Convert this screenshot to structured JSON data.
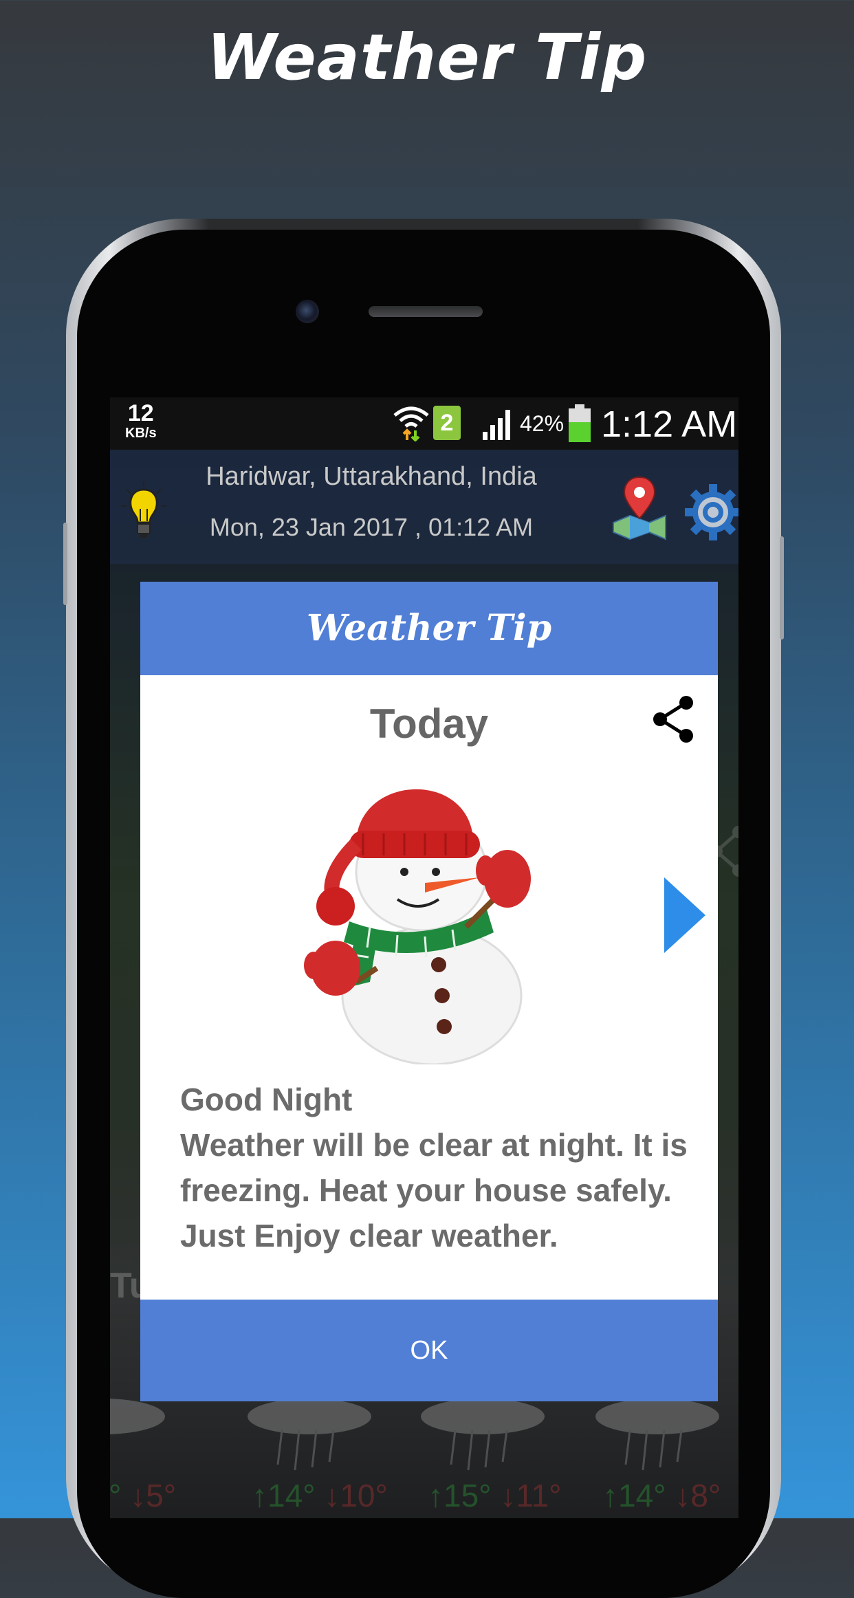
{
  "promo": {
    "title": "Weather Tip"
  },
  "status_bar": {
    "speed_value": "12",
    "speed_unit": "KB/s",
    "sim_slot": "2",
    "battery_percent": "42%",
    "time": "1:12 AM"
  },
  "app_bar": {
    "location": "Haridwar, Uttarakhand, India",
    "datetime": "Mon, 23 Jan 2017 , 01:12 AM"
  },
  "background": {
    "day_partial": "Tu",
    "forecast": [
      {
        "high": "",
        "low": "↓5°",
        "lead": "°"
      },
      {
        "high": "↑14°",
        "low": "↓10°",
        "lead": ""
      },
      {
        "high": "↑15°",
        "low": "↓11°",
        "lead": ""
      },
      {
        "high": "↑14°",
        "low": "↓8°",
        "lead": ""
      }
    ]
  },
  "dialog": {
    "title": "Weather Tip",
    "day": "Today",
    "tip_heading": "Good Night",
    "tip_lines": [
      "Weather will be clear at night. It is",
      "freezing. Heat your house safely.",
      "Just Enjoy clear weather."
    ],
    "ok_label": "OK"
  },
  "colors": {
    "dialog_accent": "#517fd6",
    "arrow_blue": "#2e8de8",
    "status_green": "#8cc63f"
  }
}
